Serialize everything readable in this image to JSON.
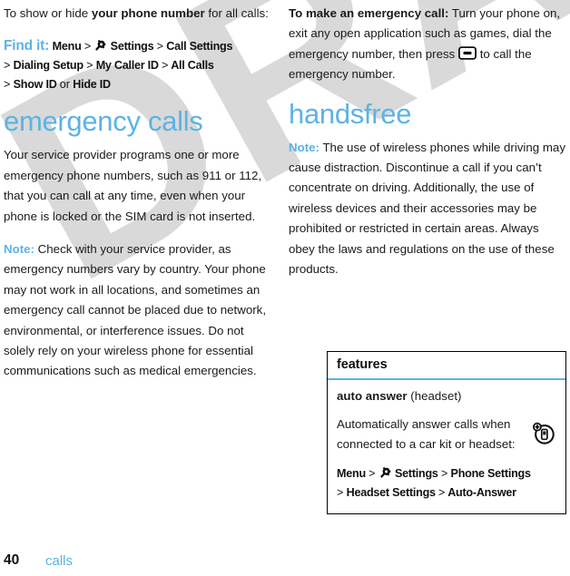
{
  "watermark": {
    "text": "DRAFT"
  },
  "colors": {
    "accent_blue": "#5cb3e4",
    "body_text": "#1a1a1a",
    "watermark_gray": "#d9d9d9",
    "rule_black": "#000000"
  },
  "left_column": {
    "intro_paragraph": {
      "lead": "To show or hide ",
      "bold": "your phone number",
      "tail": " for all calls:"
    },
    "find_it": {
      "label": "Find it:",
      "line1": {
        "menu": "Menu",
        "sep1": ">",
        "gear_icon": "gear-icon",
        "settings": "Settings",
        "sep2": ">",
        "call_settings": "Call Settings"
      },
      "line2": {
        "sep1": ">",
        "dialing_setup": "Dialing Setup",
        "sep2": ">",
        "my_caller_id": "My Caller ID",
        "sep3": ">",
        "all_calls": "All Calls"
      },
      "line3": {
        "sep1": ">",
        "show_id": "Show ID",
        "or": "or",
        "hide_id": "Hide ID"
      }
    },
    "section_title": "emergency calls",
    "paragraph_1": "Your service provider programs one or more emergency phone numbers, such as 911 or 112, that you can call at any time, even when your phone is locked or the SIM card is not inserted.",
    "note": {
      "label": "Note:",
      "text": " Check with your service provider, as emergency numbers vary by country. Your phone may not work in all locations, and sometimes an emergency call cannot be placed due to network, environmental, or interference issues. Do not solely rely on your wireless phone for essential communications such as medical emergencies."
    }
  },
  "right_column": {
    "emergency_call": {
      "bold_lead": "To make an emergency call:",
      "text_before_key": " Turn your phone on, exit any open application such as games, dial the emergency number, then press ",
      "key_icon": "send-key-icon",
      "text_after_key": " to call the emergency number."
    },
    "section_title": "handsfree",
    "note": {
      "label": "Note:",
      "text": " The use of wireless phones while driving may cause distraction. Discontinue a call if you can’t concentrate on driving. Additionally, the use of wireless devices and their accessories may be prohibited or restricted in certain areas. Always obey the laws and regulations on the use of these products."
    },
    "features_table": {
      "header": "features",
      "badge_icon": "phone-plus-circle-icon",
      "rows": [
        {
          "name_bold": "auto answer",
          "name_plain": " (headset)",
          "description": "Automatically answer calls when connected to a car kit or headset:",
          "path_line1": {
            "menu": "Menu",
            "sep1": ">",
            "gear_icon": "gear-icon",
            "settings": "Settings",
            "sep2": ">",
            "phone_settings": "Phone Settings"
          },
          "path_line2": {
            "sep1": ">",
            "headset_settings": "Headset Settings",
            "sep2": ">",
            "auto_answer": "Auto-Answer"
          }
        }
      ]
    }
  },
  "footer": {
    "page_number": "40",
    "chapter": "calls"
  }
}
